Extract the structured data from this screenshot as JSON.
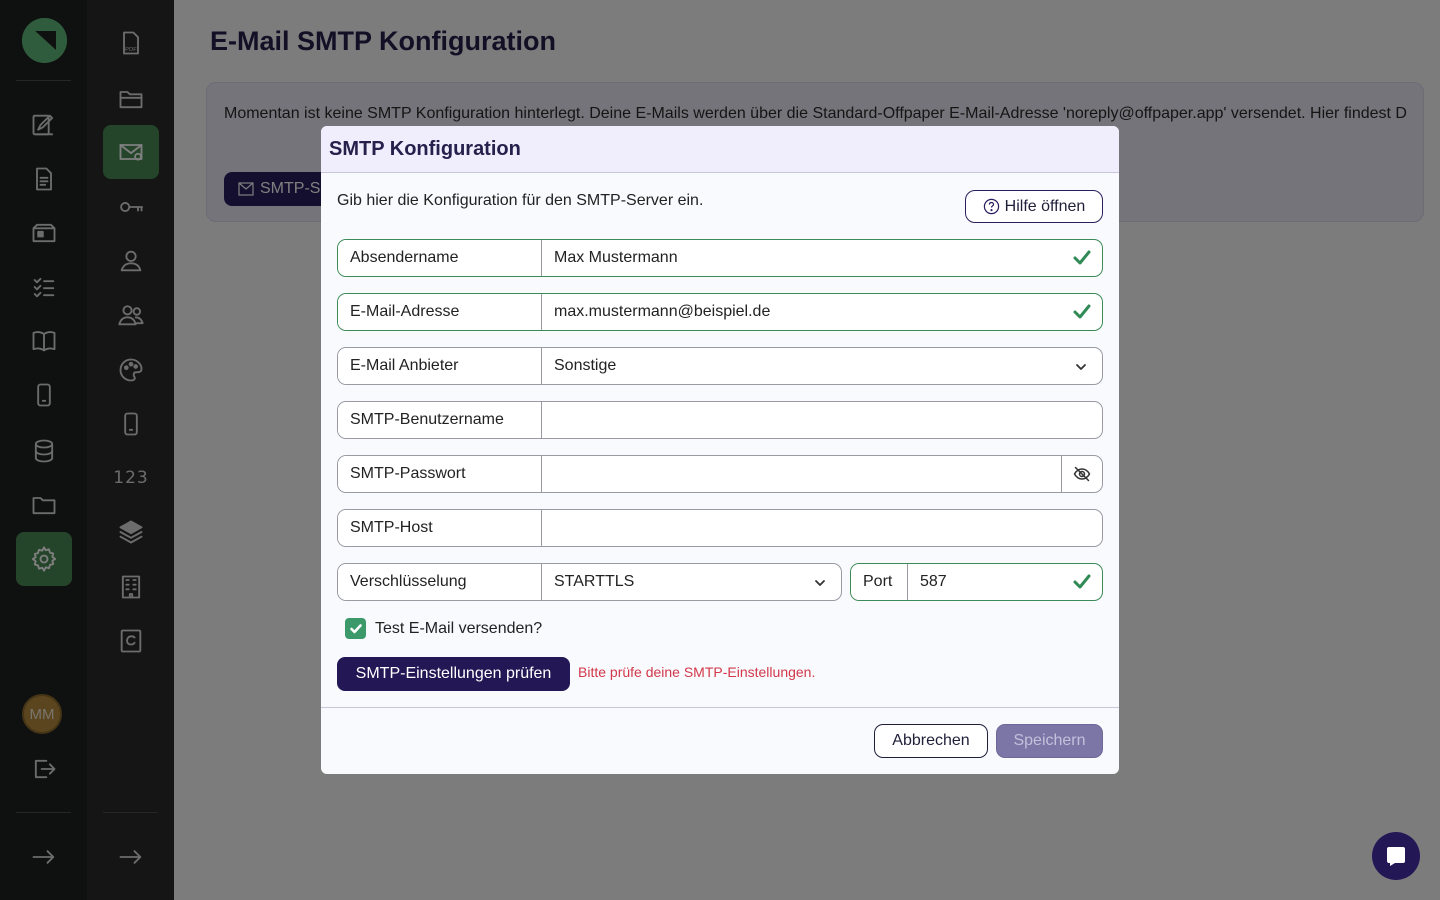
{
  "page": {
    "title": "E-Mail SMTP Konfiguration",
    "info_text": "Momentan ist keine SMTP Konfiguration hinterlegt. Deine E-Mails werden über die Standard-Offpaper E-Mail-Adresse 'noreply@offpaper.app' versendet. Hier findest D",
    "info_button_label": "SMTP-S"
  },
  "user": {
    "initials": "MM"
  },
  "sidebar_secondary": {
    "numbers_label": "123"
  },
  "modal": {
    "title": "SMTP Konfiguration",
    "intro": "Gib hier die Konfiguration für den SMTP-Server ein.",
    "help_label": "Hilfe öffnen",
    "fields": {
      "sender_name": {
        "label": "Absendername",
        "value": "Max Mustermann"
      },
      "email": {
        "label": "E-Mail-Adresse",
        "value": "max.mustermann@beispiel.de"
      },
      "provider": {
        "label": "E-Mail Anbieter",
        "value": "Sonstige"
      },
      "username": {
        "label": "SMTP-Benutzername",
        "value": ""
      },
      "password": {
        "label": "SMTP-Passwort",
        "value": ""
      },
      "host": {
        "label": "SMTP-Host",
        "value": ""
      },
      "encryption": {
        "label": "Verschlüsselung",
        "value": "STARTTLS"
      },
      "port": {
        "label": "Port",
        "value": "587"
      }
    },
    "test_email_label": "Test E-Mail versenden?",
    "test_email_checked": true,
    "test_button_label": "SMTP-Einstellungen prüfen",
    "error_text": "Bitte prüfe deine SMTP-Einstellungen.",
    "cancel_label": "Abbrechen",
    "save_label": "Speichern"
  },
  "colors": {
    "primary": "#231855",
    "success": "#2f8a55",
    "error": "#d2384a",
    "sidebar_active": "#4a8a55"
  }
}
